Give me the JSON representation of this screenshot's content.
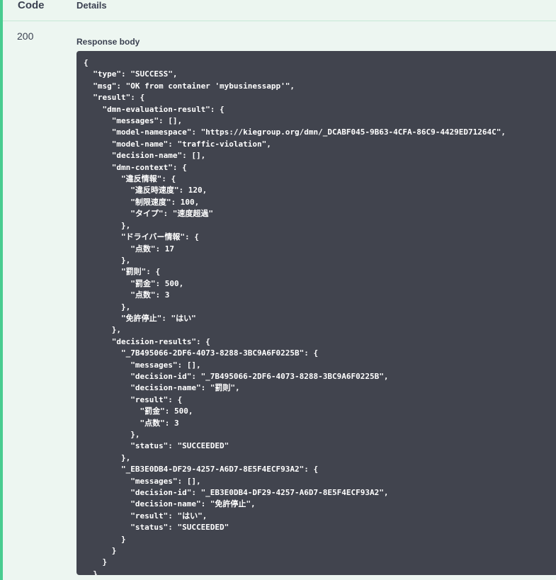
{
  "header": {
    "code_label": "Code",
    "details_label": "Details"
  },
  "response": {
    "status_code": "200",
    "body_label": "Response body",
    "body_lines": [
      "{",
      "  \"type\": \"SUCCESS\",",
      "  \"msg\": \"OK from container 'mybusinessapp'\",",
      "  \"result\": {",
      "    \"dmn-evaluation-result\": {",
      "      \"messages\": [],",
      "      \"model-namespace\": \"https://kiegroup.org/dmn/_DCABF045-9B63-4CFA-86C9-4429ED71264C\",",
      "      \"model-name\": \"traffic-violation\",",
      "      \"decision-name\": [],",
      "      \"dmn-context\": {",
      "        \"違反情報\": {",
      "          \"違反時速度\": 120,",
      "          \"制限速度\": 100,",
      "          \"タイプ\": \"速度超過\"",
      "        },",
      "        \"ドライバー情報\": {",
      "          \"点数\": 17",
      "        },",
      "        \"罰則\": {",
      "          \"罰金\": 500,",
      "          \"点数\": 3",
      "        },",
      "        \"免許停止\": \"はい\"",
      "      },",
      "      \"decision-results\": {",
      "        \"_7B495066-2DF6-4073-8288-3BC9A6F0225B\": {",
      "          \"messages\": [],",
      "          \"decision-id\": \"_7B495066-2DF6-4073-8288-3BC9A6F0225B\",",
      "          \"decision-name\": \"罰則\",",
      "          \"result\": {",
      "            \"罰金\": 500,",
      "            \"点数\": 3",
      "          },",
      "          \"status\": \"SUCCEEDED\"",
      "        },",
      "        \"_EB3E0DB4-DF29-4257-A6D7-8E5F4ECF93A2\": {",
      "          \"messages\": [],",
      "          \"decision-id\": \"_EB3E0DB4-DF29-4257-A6D7-8E5F4ECF93A2\",",
      "          \"decision-name\": \"免許停止\",",
      "          \"result\": \"はい\",",
      "          \"status\": \"SUCCEEDED\"",
      "        }",
      "      }",
      "    }",
      "  }",
      "}"
    ]
  },
  "colors": {
    "accent": "#49cc90",
    "header_bg": "#ecf6f0",
    "code_bg": "#41444e",
    "text": "#3b4151"
  }
}
